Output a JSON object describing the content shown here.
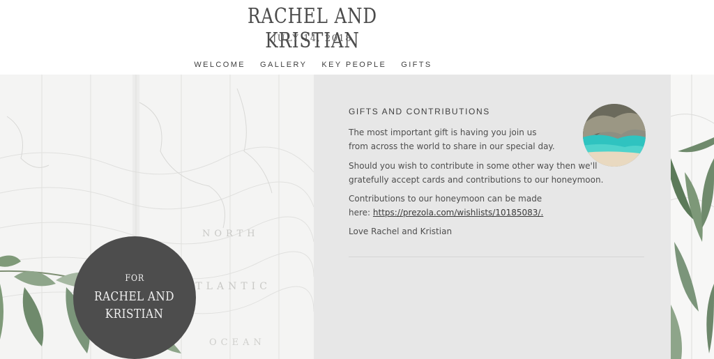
{
  "header": {
    "title": "RACHEL AND KRISTIAN",
    "date": "JULY 14, 2018"
  },
  "nav": {
    "items": [
      {
        "label": "WELCOME"
      },
      {
        "label": "GALLERY"
      },
      {
        "label": "KEY PEOPLE"
      },
      {
        "label": "GIFTS"
      }
    ]
  },
  "badge": {
    "for_label": "FOR",
    "names_line1": "RACHEL AND",
    "names_line2": "KRISTIAN"
  },
  "map": {
    "labels": [
      "NORTH",
      "ATLANTIC",
      "OCEAN"
    ]
  },
  "gifts": {
    "heading": "GIFTS AND CONTRIBUTIONS",
    "paragraph1": "The most important gift is having you join us from across the world to share in our special day.",
    "paragraph2": "Should you wish to contribute in some other way then we'll gratefully accept cards and contributions to our honeymoon.",
    "paragraph3_prefix": "Contributions to our honeymoon can be made here: ",
    "link_text": "https://prezola.com/wishlists/10185083/.",
    "signoff": "Love Rachel and Kristian"
  },
  "colors": {
    "badge_bg": "#4d4d4d",
    "content_bg": "#e7e7e7",
    "map_bg": "#f4f4f3",
    "text": "#4a4a4a",
    "leaf_green": "#6f8a6c",
    "water_teal": "#2fc3c0"
  }
}
